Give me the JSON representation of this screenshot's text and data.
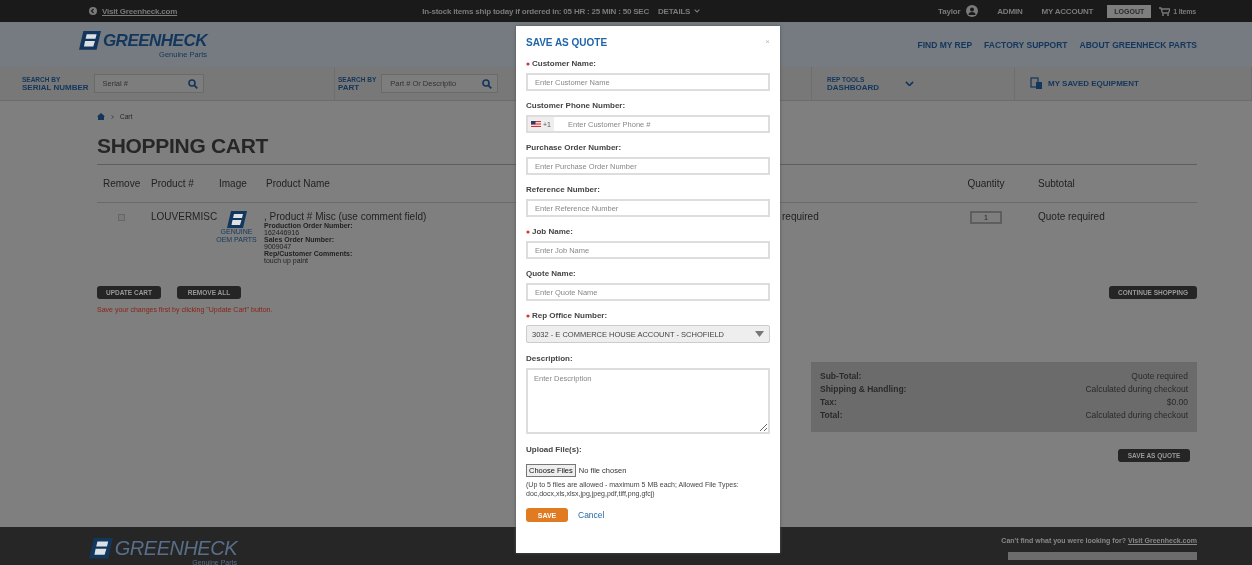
{
  "top_bar": {
    "visit_link": "Visit Greenheck.com",
    "shipping_notice": "In-stock items ship today if ordered in: 05 HR : 25 MIN : 50 SEC",
    "details_link": "DETAILS",
    "user_name": "Taylor",
    "links": [
      "ADMIN",
      "MY ACCOUNT"
    ],
    "logout_button": "LOGOUT",
    "cart_count": "1 Items"
  },
  "header": {
    "logo": {
      "name": "GREENHECK",
      "tagline": "Genuine Parts"
    },
    "nav": [
      "FIND MY REP",
      "FACTORY SUPPORT",
      "ABOUT GREENHECK PARTS"
    ]
  },
  "search_bar": {
    "serial": {
      "label_top": "SEARCH BY",
      "label_bottom": "SERIAL NUMBER",
      "placeholder": "Serial #"
    },
    "part": {
      "label_top": "SEARCH BY",
      "label_bottom": "PART",
      "placeholder": "Part # Or Descriptio"
    },
    "rep_tools": {
      "label_top": "REP TOOLS",
      "label_bottom": "DASHBOARD"
    },
    "saved_equipment": "MY SAVED EQUIPMENT"
  },
  "breadcrumb": [
    "Cart"
  ],
  "cart": {
    "title": "SHOPPING CART",
    "columns": [
      "Remove",
      "Product #",
      "Image",
      "Product Name",
      "Quantity",
      "Subtotal"
    ],
    "rows": [
      {
        "checked": false,
        "product_number": "LOUVERMISC",
        "image_caption": "GENUINE OEM PARTS",
        "name": ", Product # Misc (use comment field)",
        "details": [
          {
            "label": "Production Order Number:",
            "value": "162446916"
          },
          {
            "label": "Sales Order Number:",
            "value": "9009047"
          },
          {
            "label": "Rep/Customer Comments:",
            "value": "touch up paint"
          }
        ],
        "price": "required",
        "quantity": "1",
        "subtotal": "Quote required"
      }
    ],
    "buttons": [
      "UPDATE CART",
      "REMOVE ALL"
    ],
    "warning": "Save your changes first by clicking \"Update Cart\" button.",
    "continue_button": "CONTINUE SHOPPING"
  },
  "summary": [
    {
      "label": "Sub-Total:",
      "value": "Quote required"
    },
    {
      "label": "Shipping & Handling:",
      "value": "Calculated during checkout"
    },
    {
      "label": "Tax:",
      "value": "$0.00"
    },
    {
      "label": "Total:",
      "value": "Calculated during checkout"
    }
  ],
  "save_quote_button": "SAVE AS QUOTE",
  "footer": {
    "logo": {
      "name": "GREENHECK",
      "tagline": "Genuine Parts"
    },
    "help_text": "Can't find what you were looking for?",
    "help_link": "Visit Greenheck.com"
  },
  "modal": {
    "title": "SAVE AS QUOTE",
    "close": "×",
    "fields": [
      {
        "kind": "text",
        "label": "Customer Name:",
        "required": true,
        "placeholder": "Enter Customer Name"
      },
      {
        "kind": "phone",
        "label": "Customer Phone Number:",
        "required": false,
        "dial_code": "+1",
        "placeholder": "Enter Customer Phone #"
      },
      {
        "kind": "text",
        "label": "Purchase Order Number:",
        "required": false,
        "placeholder": "Enter Purchase Order Number"
      },
      {
        "kind": "text",
        "label": "Reference Number:",
        "required": false,
        "placeholder": "Enter Reference Number"
      },
      {
        "kind": "text",
        "label": "Job Name:",
        "required": true,
        "placeholder": "Enter Job Name"
      },
      {
        "kind": "text",
        "label": "Quote Name:",
        "required": false,
        "placeholder": "Enter Quote Name"
      },
      {
        "kind": "select",
        "label": "Rep Office Number:",
        "required": true,
        "value": "3032 - E COMMERCE HOUSE ACCOUNT - SCHOFIELD"
      },
      {
        "kind": "textarea",
        "label": "Description:",
        "required": false,
        "placeholder": "Enter Description"
      },
      {
        "kind": "file",
        "label": "Upload File(s):",
        "required": false,
        "button": "Choose Files",
        "status": "No file chosen",
        "note": "(Up to 5 files are allowed - maximum 5 MB each; Allowed File Types: doc,docx,xls,xlsx,jpg,jpeg,pdf,tiff,png,gfcj)"
      }
    ],
    "save_button": "SAVE",
    "cancel_link": "Cancel"
  }
}
